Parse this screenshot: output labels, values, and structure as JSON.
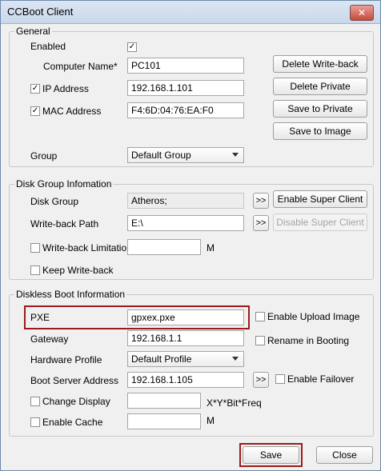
{
  "window": {
    "title": "CCBoot Client",
    "close_glyph": "✕"
  },
  "general": {
    "legend": "General",
    "enabled_label": "Enabled",
    "enabled_checked": true,
    "computer_name_label": "Computer Name*",
    "computer_name_value": "PC101",
    "ip_label": "IP Address",
    "ip_checked": true,
    "ip_value": "192.168.1.101",
    "mac_label": "MAC Address",
    "mac_checked": true,
    "mac_value": "F4:6D:04:76:EA:F0",
    "group_label": "Group",
    "group_value": "Default Group",
    "buttons": {
      "delete_writeback": "Delete Write-back",
      "delete_private": "Delete Private",
      "save_to_private": "Save to Private",
      "save_to_image": "Save to Image"
    }
  },
  "disk": {
    "legend": "Disk Group Infomation",
    "disk_group_label": "Disk Group",
    "disk_group_value": "Atheros;",
    "writeback_path_label": "Write-back Path",
    "writeback_path_value": "E:\\",
    "browse_label": ">>",
    "enable_super_client": "Enable Super Client",
    "disable_super_client": "Disable Super Client",
    "writeback_limit_label": "Write-back Limitation",
    "writeback_limit_checked": false,
    "writeback_limit_value": "",
    "unit_m": "M",
    "keep_writeback_label": "Keep Write-back",
    "keep_writeback_checked": false
  },
  "diskless": {
    "legend": "Diskless Boot Information",
    "pxe_label": "PXE",
    "pxe_value": "gpxex.pxe",
    "enable_upload_label": "Enable Upload Image",
    "enable_upload_checked": false,
    "gateway_label": "Gateway",
    "gateway_value": "192.168.1.1",
    "rename_label": "Rename in Booting",
    "rename_checked": false,
    "hardware_label": "Hardware Profile",
    "hardware_value": "Default Profile",
    "boot_server_label": "Boot Server Address",
    "boot_server_value": "192.168.1.105",
    "browse_label": ">>",
    "enable_failover_label": "Enable Failover",
    "enable_failover_checked": false,
    "change_display_label": "Change Display",
    "change_display_checked": false,
    "change_display_value": "",
    "display_hint": "X*Y*Bit*Freq",
    "enable_cache_label": "Enable Cache",
    "enable_cache_checked": false,
    "cache_value": "",
    "unit_m": "M"
  },
  "footer": {
    "save": "Save",
    "close": "Close"
  },
  "colors": {
    "highlight": "#9b1b1b"
  }
}
